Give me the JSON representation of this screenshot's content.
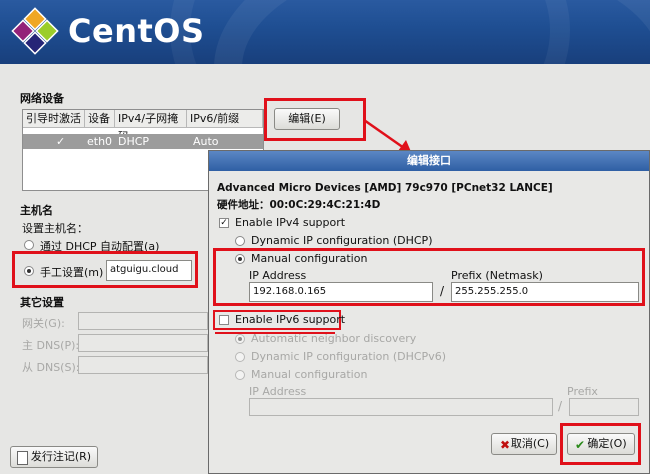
{
  "brand": {
    "name": "CentOS"
  },
  "network_devices": {
    "section_label": "网络设备",
    "columns": [
      "引导时激活",
      "设备",
      "IPv4/子网掩码",
      "IPv6/前缀"
    ],
    "row": {
      "active": "✓",
      "device": "eth0",
      "ipv4": "DHCP",
      "ipv6": "Auto"
    },
    "edit_button": "编辑(E)"
  },
  "hostname": {
    "section_label": "主机名",
    "set_label": "设置主机名：",
    "dhcp_option": "通过 DHCP 自动配置(a)",
    "manual_option": "手工设置(m)",
    "manual_value": "atguigu.cloud"
  },
  "other_settings": {
    "section_label": "其它设置",
    "gateway_label": "网关(G):",
    "dns1_label": "主 DNS(P):",
    "dns2_label": "从 DNS(S):"
  },
  "release_notes_button": "发行注记(R)",
  "dialog": {
    "title": "编辑接口",
    "device_name": "Advanced Micro Devices [AMD] 79c970 [PCnet32 LANCE]",
    "hw_address": "硬件地址：00:0C:29:4C:21:4D",
    "enable_ipv4": "Enable IPv4 support",
    "dynamic_ip": "Dynamic IP configuration (DHCP)",
    "manual_config": "Manual configuration",
    "ip_address_label": "IP Address",
    "prefix_label": "Prefix (Netmask)",
    "ip_value": "192.168.0.165",
    "slash": "/",
    "prefix_value": "255.255.255.0",
    "enable_ipv6": "Enable IPv6 support",
    "auto_neighbor": "Automatic neighbor discovery",
    "dynamic_ipv6": "Dynamic IP configuration (DHCPv6)",
    "manual_config6": "Manual configuration",
    "ip_address6_label": "IP Address",
    "prefix6_label": "Prefix",
    "cancel_button": "取消(C)",
    "ok_button": "确定(O)"
  },
  "colors": {
    "highlight": "#e0101a",
    "header": "#1f4f93",
    "dialog_title": "#2f5fa4"
  }
}
